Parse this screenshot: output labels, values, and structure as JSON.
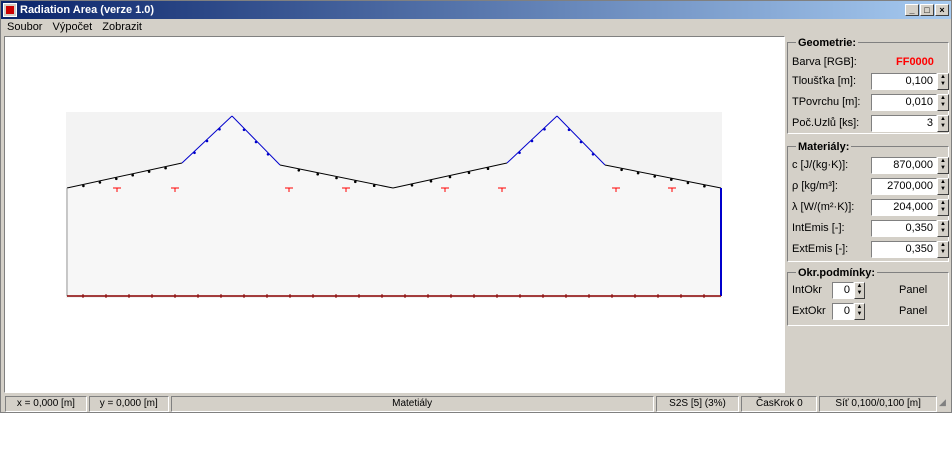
{
  "window": {
    "title": "Radiation Area (verze 1.0)",
    "controls": {
      "minimize": "_",
      "maximize": "□",
      "close": "×"
    }
  },
  "menu": [
    "Soubor",
    "Výpočet",
    "Zobrazit"
  ],
  "geometrie": {
    "title": "Geometrie:",
    "barva_label": "Barva  [RGB]:",
    "barva_value": "FF0000",
    "barva_color": "#ff0000",
    "tloustka_label": "Tloušťka [m]:",
    "tloustka_value": "0,100",
    "tpovrchu_label": "TPovrchu [m]:",
    "tpovrchu_value": "0,010",
    "poc_uzlu_label": "Poč.Uzlů [ks]:",
    "poc_uzlu_value": "3"
  },
  "materialy": {
    "title": "Materiály:",
    "c_label": "c [J/(kg·K)]:",
    "c_value": "870,000",
    "rho_label": "ρ [kg/m³]:",
    "rho_value": "2700,000",
    "lambda_label": "λ [W/(m²·K)]:",
    "lambda_value": "204,000",
    "intemis_label": "IntEmis [-]:",
    "intemis_value": "0,350",
    "extemis_label": "ExtEmis [-]:",
    "extemis_value": "0,350"
  },
  "okr": {
    "title": "Okr.podmínky:",
    "intokr_label": "IntOkr",
    "intokr_value": "0",
    "intokr_panel": "Panel",
    "extokr_label": "ExtOkr",
    "extokr_value": "0",
    "extokr_panel": "Panel"
  },
  "status": {
    "x": "x = 0,000 [m]",
    "y": "y = 0,000 [m]",
    "mode": "Matetiály",
    "s2s": "S2S [5] (3%)",
    "caskrok": "ČasKrok 0",
    "sit": "Síť 0,100/0,100 [m]"
  },
  "colors": {
    "outline": "#000000",
    "peak_edges": "#0000cc",
    "bottom_edge": "#880000",
    "markers": "#ff0000",
    "area_fill": "#f3f3f3"
  }
}
